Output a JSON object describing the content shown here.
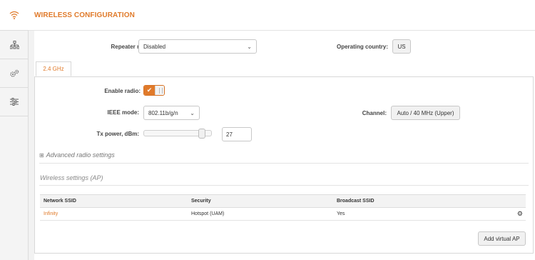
{
  "header": {
    "title": "WIRELESS CONFIGURATION"
  },
  "sidebar": {
    "items": [
      {
        "icon": "wifi-icon"
      },
      {
        "icon": "network-icon"
      },
      {
        "icon": "services-gears-icon"
      },
      {
        "icon": "settings-sliders-icon"
      }
    ]
  },
  "top": {
    "repeater_label": "Repeater mode:",
    "repeater_value": "Disabled",
    "country_label": "Operating country:",
    "country_value": "US"
  },
  "tabs": [
    {
      "label": "2.4 GHz"
    }
  ],
  "radio": {
    "enable_label": "Enable radio:",
    "enabled": true,
    "ieee_label": "IEEE mode:",
    "ieee_value": "802.11b/g/n",
    "channel_label": "Channel:",
    "channel_value": "Auto / 40 MHz (Upper)",
    "txpower_label": "Tx power, dBm:",
    "txpower_value": "27",
    "txpower_level": 0.9,
    "advanced_label": "Advanced radio settings"
  },
  "wireless": {
    "section_title": "Wireless settings (AP)",
    "columns": [
      "Network SSID",
      "Security",
      "Broadcast SSID"
    ],
    "rows": [
      {
        "ssid": "Infinity",
        "security": "Hotspot (UAM)",
        "broadcast": "Yes"
      }
    ],
    "add_button": "Add virtual AP"
  },
  "colors": {
    "accent": "#e07a2a"
  }
}
